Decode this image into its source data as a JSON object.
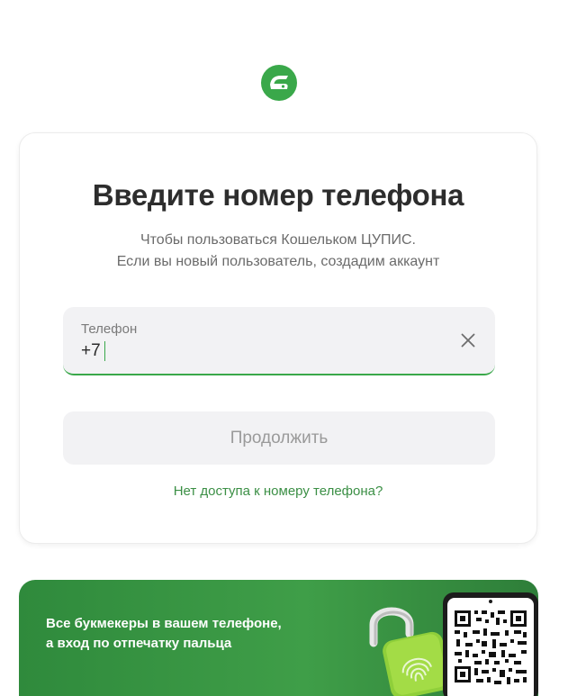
{
  "logo": {
    "icon": "wallet-logo-icon",
    "color": "#3aa84a"
  },
  "card": {
    "title": "Введите номер телефона",
    "subtitle_line1": "Чтобы пользоваться Кошельком ЦУПИС.",
    "subtitle_line2": "Если вы новый пользователь, создадим аккаунт",
    "phone": {
      "label": "Телефон",
      "value": "+7",
      "clear_icon": "close-icon"
    },
    "continue_label": "Продолжить",
    "no_access_link": "Нет доступа к номеру телефона?"
  },
  "banner": {
    "line1": "Все букмекеры в вашем телефоне,",
    "line2": "а вход по отпечатку пальца",
    "art_icons": [
      "padlock-fingerprint-icon",
      "phone-qr-code-icon"
    ]
  },
  "colors": {
    "accent": "#3aa84a",
    "link": "#3b8f45",
    "banner": "#3f9e48",
    "field_bg": "#f2f2f4"
  }
}
